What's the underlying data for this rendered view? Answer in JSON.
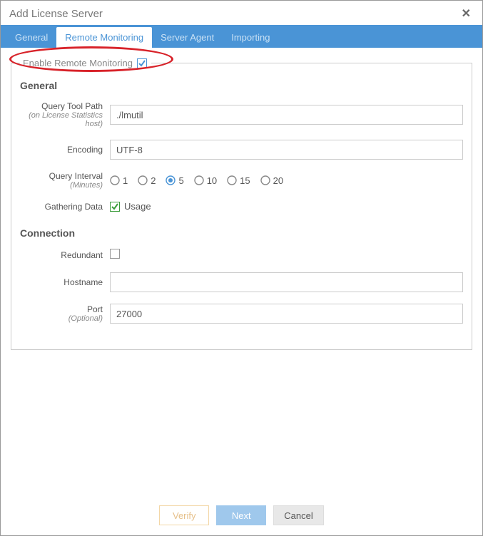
{
  "dialog": {
    "title": "Add License Server"
  },
  "tabs": {
    "general": "General",
    "remote": "Remote Monitoring",
    "agent": "Server Agent",
    "importing": "Importing"
  },
  "enable_section": {
    "label": "Enable Remote Monitoring",
    "checked": true
  },
  "general": {
    "title": "General",
    "query_tool_label": "Query Tool Path",
    "query_tool_sub": "(on License Statistics host)",
    "query_tool_value": "./lmutil",
    "encoding_label": "Encoding",
    "encoding_value": "UTF-8",
    "interval_label": "Query Interval",
    "interval_sub": "(Minutes)",
    "interval_options": [
      "1",
      "2",
      "5",
      "10",
      "15",
      "20"
    ],
    "interval_selected": "5",
    "gathering_label": "Gathering Data",
    "gathering_usage_label": "Usage",
    "gathering_usage_checked": true
  },
  "connection": {
    "title": "Connection",
    "redundant_label": "Redundant",
    "redundant_checked": false,
    "hostname_label": "Hostname",
    "hostname_value": "",
    "port_label": "Port",
    "port_sub": "(Optional)",
    "port_value": "27000"
  },
  "footer": {
    "verify": "Verify",
    "next": "Next",
    "cancel": "Cancel"
  }
}
